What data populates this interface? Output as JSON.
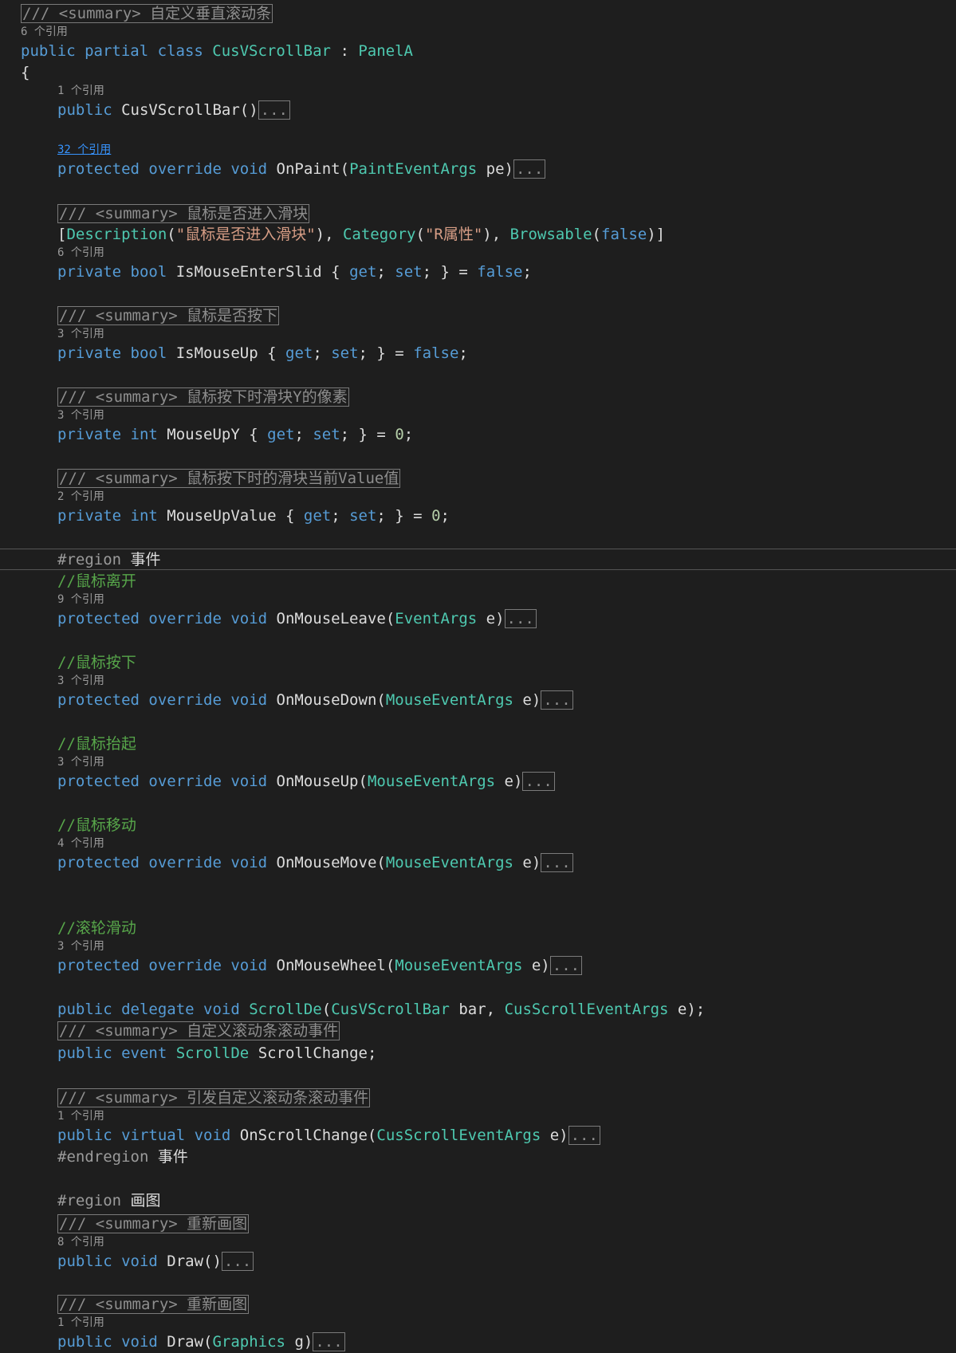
{
  "summary_prefix": "/// <summary>",
  "ellipsis": "...",
  "lines": {
    "cls_summary": "自定义垂直滚动条",
    "cls_refs": "6 个引用",
    "cls_public": "public",
    "cls_partial": "partial",
    "cls_class": "class",
    "cls_name": "CusVScrollBar",
    "cls_colon": " : ",
    "cls_base": "PanelA",
    "open_brace": "{",
    "ctor_refs": "1 个引用",
    "ctor_public": "public",
    "ctor_sig": " CusVScrollBar()",
    "paint_refs": "32 个引用",
    "paint_kw": "protected override void",
    "paint_name": " OnPaint(",
    "paint_type": "PaintEventArgs",
    "paint_param": " pe)",
    "slid_summary": "鼠标是否进入滑块",
    "attr_open": "[",
    "attr_desc": "Description",
    "attr_desc_arg": "\"鼠标是否进入滑块\"",
    "attr_comma1": "), ",
    "attr_cat": "Category",
    "attr_cat_arg": "\"R属性\"",
    "attr_comma2": "), ",
    "attr_brow": "Browsable",
    "attr_false": "false",
    "attr_close": ")]",
    "slid_refs": "6 个引用",
    "slid_mod": "private bool",
    "slid_name": " IsMouseEnterSlid { ",
    "slid_get": "get",
    "slid_mid": "; ",
    "slid_set": "set",
    "slid_end": "; } = ",
    "slid_val": "false",
    "slid_semi": ";",
    "up_summary": "鼠标是否按下",
    "up_refs": "3 个引用",
    "up_mod": "private bool",
    "up_name": " IsMouseUp { ",
    "up_get": "get",
    "up_mid": "; ",
    "up_set": "set",
    "up_end": "; } = ",
    "up_val": "false",
    "up_semi": ";",
    "upy_summary": "鼠标按下时滑块Y的像素",
    "upy_refs": "3 个引用",
    "upy_mod": "private int",
    "upy_name": " MouseUpY { ",
    "upy_get": "get",
    "upy_mid": "; ",
    "upy_set": "set",
    "upy_end": "; } = ",
    "upy_val": "0",
    "upy_semi": ";",
    "upv_summary": "鼠标按下时的滑块当前Value值",
    "upv_refs": "2 个引用",
    "upv_mod": "private int",
    "upv_name": " MouseUpValue { ",
    "upv_get": "get",
    "upv_mid": "; ",
    "upv_set": "set",
    "upv_end": "; } = ",
    "upv_val": "0",
    "upv_semi": ";",
    "region1_kw": "#region",
    "region1_name": " 事件",
    "leave_comment": "//鼠标离开",
    "leave_refs": "9 个引用",
    "leave_kw": "protected override void",
    "leave_name": " OnMouseLeave(",
    "leave_type": "EventArgs",
    "leave_param": " e)",
    "down_comment": "//鼠标按下",
    "down_refs": "3 个引用",
    "down_kw": "protected override void",
    "down_name": " OnMouseDown(",
    "down_type": "MouseEventArgs",
    "down_param": " e)",
    "mup_comment": "//鼠标抬起",
    "mup_refs": "3 个引用",
    "mup_kw": "protected override void",
    "mup_name": " OnMouseUp(",
    "mup_type": "MouseEventArgs",
    "mup_param": " e)",
    "move_comment": "//鼠标移动",
    "move_refs": "4 个引用",
    "move_kw": "protected override void",
    "move_name": " OnMouseMove(",
    "move_type": "MouseEventArgs",
    "move_param": " e)",
    "wheel_comment": "//滚轮滑动",
    "wheel_refs": "3 个引用",
    "wheel_kw": "protected override void",
    "wheel_name": " OnMouseWheel(",
    "wheel_type": "MouseEventArgs",
    "wheel_param": " e)",
    "del_kw": "public delegate void",
    "del_type": "ScrollDe",
    "del_open": "(",
    "del_t1": "CusVScrollBar",
    "del_p1": " bar, ",
    "del_t2": "CusScrollEventArgs",
    "del_p2": " e);",
    "evt_summary": "自定义滚动条滚动事件",
    "evt_kw": "public event",
    "evt_type": "ScrollDe",
    "evt_name": " ScrollChange;",
    "raise_summary": "引发自定义滚动条滚动事件",
    "raise_refs": "1 个引用",
    "raise_kw": "public virtual void",
    "raise_name": " OnScrollChange(",
    "raise_type": "CusScrollEventArgs",
    "raise_param": " e)",
    "endregion1_kw": "#endregion",
    "endregion1_name": " 事件",
    "region2_kw": "#region",
    "region2_name": " 画图",
    "draw1_summary": "重新画图",
    "draw1_refs": "8 个引用",
    "draw1_kw": "public void",
    "draw1_name": " Draw()",
    "draw2_summary": "重新画图",
    "draw2_refs": "1 个引用",
    "draw2_kw": "public void",
    "draw2_name": " Draw(",
    "draw2_type": "Graphics",
    "draw2_param": " g)"
  }
}
